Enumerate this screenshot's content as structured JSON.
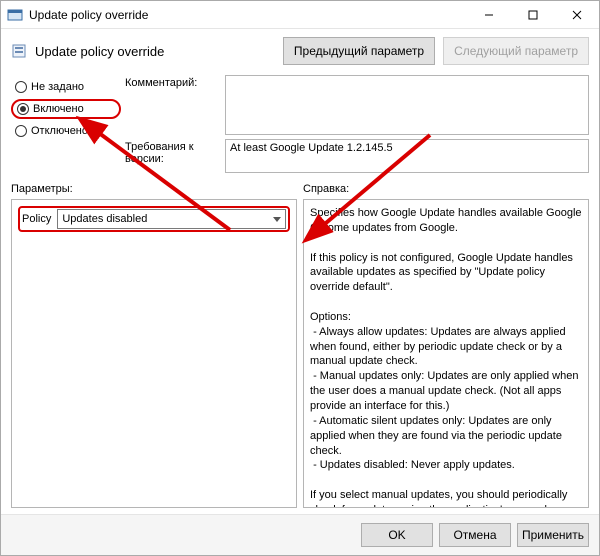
{
  "titlebar": {
    "title": "Update policy override"
  },
  "header": {
    "subtitle": "Update policy override",
    "prev_btn": "Предыдущий параметр",
    "next_btn": "Следующий параметр"
  },
  "state": {
    "not_configured": "Не задано",
    "enabled": "Включено",
    "disabled": "Отключено"
  },
  "labels": {
    "comment": "Комментарий:",
    "supported": "Требования к версии:",
    "options": "Параметры:",
    "help": "Справка:"
  },
  "version_text": "At least Google Update 1.2.145.5",
  "policy": {
    "label": "Policy",
    "value": "Updates disabled"
  },
  "help_text": "Specifies how Google Update handles available Google Chrome updates from Google.\n\nIf this policy is not configured, Google Update handles available updates as specified by \"Update policy override default\".\n\nOptions:\n - Always allow updates: Updates are always applied when found, either by periodic update check or by a manual update check.\n - Manual updates only: Updates are only applied when the user does a manual update check. (Not all apps provide an interface for this.)\n - Automatic silent updates only: Updates are only applied when they are found via the periodic update check.\n - Updates disabled: Never apply updates.\n\nIf you select manual updates, you should periodically check for updates using the application's manual update mechanism if available. If you disable updates, you should periodically check for updates and distribute them to users. Check",
  "footer": {
    "ok": "OK",
    "cancel": "Отмена",
    "apply": "Применить"
  }
}
